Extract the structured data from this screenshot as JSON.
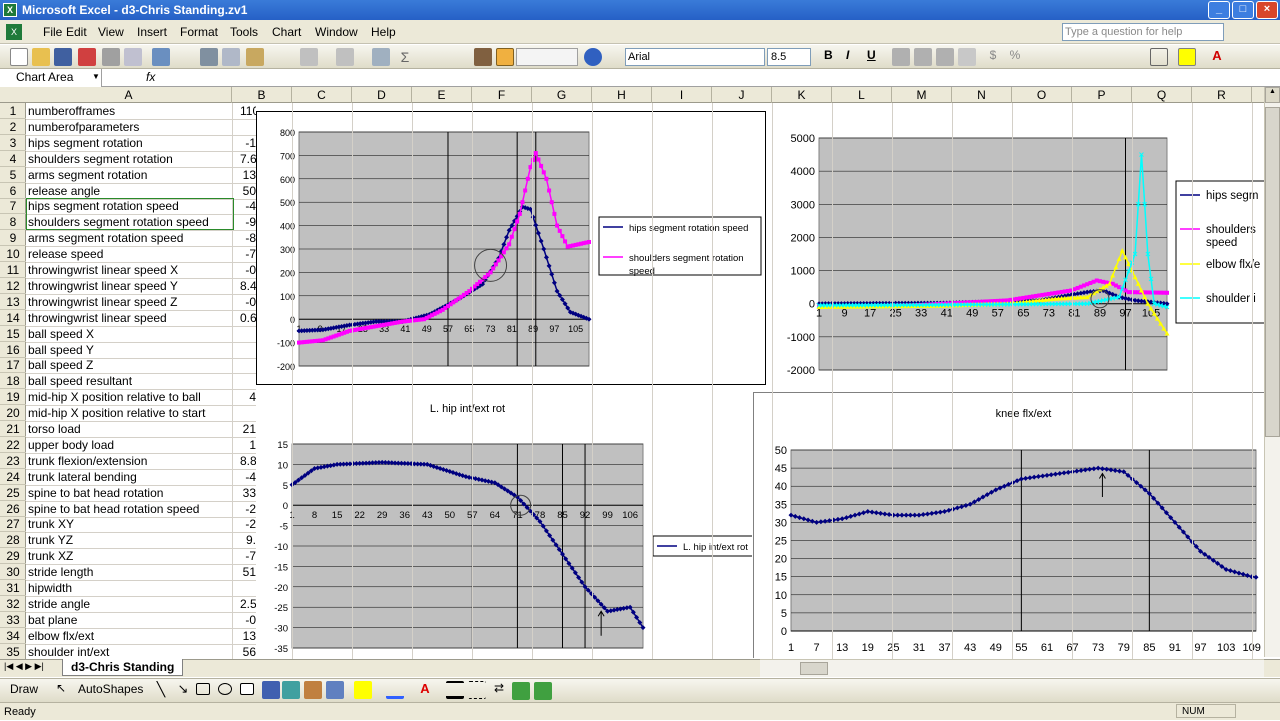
{
  "window": {
    "title": "Microsoft Excel - d3-Chris Standing.zv1"
  },
  "menu": [
    "File",
    "Edit",
    "View",
    "Insert",
    "Format",
    "Tools",
    "Chart",
    "Window",
    "Help"
  ],
  "ask_placeholder": "Type a question for help",
  "font": {
    "name": "Arial",
    "size": "8.5",
    "bold": "B",
    "italic": "I",
    "underline": "U"
  },
  "name_box": "Chart Area",
  "fx": "fx",
  "columns": [
    "A",
    "B",
    "C",
    "D",
    "E",
    "F",
    "G",
    "H",
    "I",
    "J",
    "K",
    "L",
    "M",
    "N",
    "O",
    "P",
    "Q",
    "R"
  ],
  "rows": [
    {
      "n": "1",
      "a": "numberofframes",
      "b": "110"
    },
    {
      "n": "2",
      "a": "numberofparameters",
      "b": ""
    },
    {
      "n": "3",
      "a": "hips segment rotation",
      "b": "-1"
    },
    {
      "n": "4",
      "a": "shoulders segment rotation",
      "b": "7.6"
    },
    {
      "n": "5",
      "a": "arms segment rotation",
      "b": "13"
    },
    {
      "n": "6",
      "a": "release angle",
      "b": "50"
    },
    {
      "n": "7",
      "a": "hips segment rotation speed",
      "b": "-4"
    },
    {
      "n": "8",
      "a": "shoulders segment rotation speed",
      "b": "-9"
    },
    {
      "n": "9",
      "a": "arms segment rotation speed",
      "b": "-8"
    },
    {
      "n": "10",
      "a": "release speed",
      "b": "-7"
    },
    {
      "n": "11",
      "a": "throwingwrist linear speed X",
      "b": "-0"
    },
    {
      "n": "12",
      "a": "throwingwrist linear speed Y",
      "b": "8.4"
    },
    {
      "n": "13",
      "a": "throwingwrist linear speed Z",
      "b": "-0"
    },
    {
      "n": "14",
      "a": "throwingwrist linear speed",
      "b": "0.6"
    },
    {
      "n": "15",
      "a": "ball speed X",
      "b": ""
    },
    {
      "n": "16",
      "a": "ball speed Y",
      "b": ""
    },
    {
      "n": "17",
      "a": "ball speed Z",
      "b": ""
    },
    {
      "n": "18",
      "a": "ball speed resultant",
      "b": ""
    },
    {
      "n": "19",
      "a": "mid-hip X position relative to ball",
      "b": "4"
    },
    {
      "n": "20",
      "a": "mid-hip X position relative to start",
      "b": ""
    },
    {
      "n": "21",
      "a": "torso load",
      "b": "21"
    },
    {
      "n": "22",
      "a": "upper body load",
      "b": "1"
    },
    {
      "n": "23",
      "a": "trunk flexion/extension",
      "b": "8.8"
    },
    {
      "n": "24",
      "a": "trunk lateral bending",
      "b": "-4"
    },
    {
      "n": "25",
      "a": "spine to bat head rotation",
      "b": "33"
    },
    {
      "n": "26",
      "a": "spine to bat head rotation speed",
      "b": "-2"
    },
    {
      "n": "27",
      "a": "trunk XY",
      "b": "-2"
    },
    {
      "n": "28",
      "a": "trunk YZ",
      "b": "9."
    },
    {
      "n": "29",
      "a": "trunk XZ",
      "b": "-7"
    },
    {
      "n": "30",
      "a": "stride length",
      "b": "51"
    },
    {
      "n": "31",
      "a": "hipwidth",
      "b": ""
    },
    {
      "n": "32",
      "a": "stride angle",
      "b": "2.5"
    },
    {
      "n": "33",
      "a": "bat plane",
      "b": "-0"
    },
    {
      "n": "34",
      "a": "elbow flx/ext",
      "b": "13"
    },
    {
      "n": "35",
      "a": "shoulder int/ext",
      "b": "56"
    }
  ],
  "sheet_tab": "d3-Chris Standing",
  "draw_toolbar": {
    "draw": "Draw",
    "autoshapes": "AutoShapes"
  },
  "status": {
    "left": "Ready",
    "num": "NUM"
  },
  "colors": {
    "series1": "#000080",
    "series2": "#ff00ff",
    "series3": "#ffff00",
    "series4": "#00ffff",
    "plot_bg": "#c0c0c0"
  },
  "chart_data": [
    {
      "type": "line",
      "title": "",
      "categories_ticks": [
        "1",
        "9",
        "17",
        "25",
        "33",
        "41",
        "49",
        "57",
        "65",
        "73",
        "81",
        "89",
        "97",
        "105"
      ],
      "yticks": [
        "800",
        "700",
        "600",
        "500",
        "400",
        "300",
        "200",
        "100",
        "0",
        "-100",
        "-200"
      ],
      "ylim": [
        -200,
        800
      ],
      "x_range": [
        1,
        110
      ],
      "series": [
        {
          "name": "hips segment rotation speed",
          "points": [
            [
              1,
              -50
            ],
            [
              10,
              -45
            ],
            [
              20,
              -25
            ],
            [
              30,
              -10
            ],
            [
              40,
              -10
            ],
            [
              50,
              20
            ],
            [
              60,
              80
            ],
            [
              70,
              150
            ],
            [
              76,
              260
            ],
            [
              80,
              380
            ],
            [
              85,
              480
            ],
            [
              88,
              470
            ],
            [
              93,
              300
            ],
            [
              98,
              120
            ],
            [
              103,
              30
            ],
            [
              110,
              0
            ]
          ]
        },
        {
          "name": "shoulders segment rotation speed",
          "points": [
            [
              1,
              -100
            ],
            [
              10,
              -90
            ],
            [
              20,
              -50
            ],
            [
              30,
              -30
            ],
            [
              40,
              -10
            ],
            [
              48,
              0
            ],
            [
              55,
              40
            ],
            [
              65,
              120
            ],
            [
              73,
              200
            ],
            [
              80,
              320
            ],
            [
              84,
              450
            ],
            [
              88,
              650
            ],
            [
              90,
              710
            ],
            [
              94,
              600
            ],
            [
              98,
              400
            ],
            [
              102,
              310
            ],
            [
              106,
              320
            ],
            [
              110,
              330
            ]
          ]
        }
      ]
    },
    {
      "type": "line",
      "title": "",
      "categories_ticks": [
        "1",
        "9",
        "17",
        "25",
        "33",
        "41",
        "49",
        "57",
        "65",
        "73",
        "81",
        "89",
        "97",
        "105"
      ],
      "yticks": [
        "5000",
        "4000",
        "3000",
        "2000",
        "1000",
        "0",
        "-1000",
        "-2000"
      ],
      "ylim": [
        -2000,
        5000
      ],
      "x_range": [
        1,
        110
      ],
      "series": [
        {
          "name": "hips segm",
          "points": [
            [
              1,
              0
            ],
            [
              40,
              20
            ],
            [
              70,
              100
            ],
            [
              85,
              350
            ],
            [
              90,
              400
            ],
            [
              95,
              200
            ],
            [
              100,
              100
            ],
            [
              110,
              0
            ]
          ]
        },
        {
          "name": "shoulders segment speed",
          "points": [
            [
              1,
              -100
            ],
            [
              30,
              -50
            ],
            [
              60,
              100
            ],
            [
              80,
              400
            ],
            [
              88,
              700
            ],
            [
              93,
              600
            ],
            [
              98,
              350
            ],
            [
              110,
              330
            ]
          ]
        },
        {
          "name": "elbow flx/e",
          "points": [
            [
              1,
              -100
            ],
            [
              20,
              -80
            ],
            [
              40,
              -60
            ],
            [
              60,
              0
            ],
            [
              75,
              150
            ],
            [
              85,
              200
            ],
            [
              92,
              600
            ],
            [
              96,
              1600
            ],
            [
              100,
              800
            ],
            [
              104,
              0
            ],
            [
              110,
              -900
            ]
          ]
        },
        {
          "name": "shoulder i",
          "points": [
            [
              1,
              -50
            ],
            [
              30,
              -40
            ],
            [
              60,
              -20
            ],
            [
              85,
              0
            ],
            [
              95,
              200
            ],
            [
              100,
              1500
            ],
            [
              102,
              4500
            ],
            [
              104,
              1500
            ],
            [
              106,
              0
            ],
            [
              110,
              -100
            ]
          ]
        }
      ]
    },
    {
      "type": "line",
      "title": "L. hip int/ext rot",
      "categories_ticks": [
        "1",
        "8",
        "15",
        "22",
        "29",
        "36",
        "43",
        "50",
        "57",
        "64",
        "71",
        "78",
        "85",
        "92",
        "99",
        "106"
      ],
      "yticks": [
        "15",
        "10",
        "5",
        "0",
        "-5",
        "-10",
        "-15",
        "-20",
        "-25",
        "-30",
        "-35"
      ],
      "ylim": [
        -35,
        15
      ],
      "x_range": [
        1,
        110
      ],
      "series": [
        {
          "name": "L. hip int/ext rot",
          "points": [
            [
              1,
              5
            ],
            [
              8,
              9
            ],
            [
              15,
              10
            ],
            [
              29,
              10.5
            ],
            [
              43,
              10
            ],
            [
              55,
              7
            ],
            [
              64,
              5.5
            ],
            [
              71,
              2
            ],
            [
              78,
              -4
            ],
            [
              85,
              -12
            ],
            [
              92,
              -20
            ],
            [
              99,
              -26
            ],
            [
              106,
              -25
            ],
            [
              110,
              -30
            ]
          ]
        }
      ]
    },
    {
      "type": "line",
      "title": "knee flx/ext",
      "categories_ticks": [
        "1",
        "7",
        "13",
        "19",
        "25",
        "31",
        "37",
        "43",
        "49",
        "55",
        "61",
        "67",
        "73",
        "79",
        "85",
        "91",
        "97",
        "103",
        "109"
      ],
      "yticks": [
        "50",
        "45",
        "40",
        "35",
        "30",
        "25",
        "20",
        "15",
        "10",
        "5",
        "0"
      ],
      "ylim": [
        0,
        50
      ],
      "x_range": [
        1,
        110
      ],
      "series": [
        {
          "name": "knee flx/ext",
          "points": [
            [
              1,
              32
            ],
            [
              7,
              30
            ],
            [
              13,
              31
            ],
            [
              19,
              33
            ],
            [
              25,
              32
            ],
            [
              31,
              32
            ],
            [
              37,
              33
            ],
            [
              43,
              35
            ],
            [
              49,
              39
            ],
            [
              55,
              42
            ],
            [
              61,
              43
            ],
            [
              67,
              44
            ],
            [
              73,
              45
            ],
            [
              79,
              44
            ],
            [
              85,
              38
            ],
            [
              91,
              30
            ],
            [
              97,
              22
            ],
            [
              103,
              17
            ],
            [
              109,
              15
            ]
          ]
        }
      ]
    }
  ]
}
